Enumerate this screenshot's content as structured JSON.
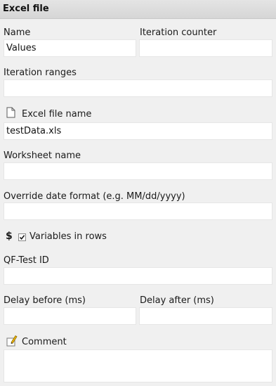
{
  "panel": {
    "title": "Excel file"
  },
  "fields": {
    "name": {
      "label": "Name",
      "value": "Values"
    },
    "iteration_counter": {
      "label": "Iteration counter",
      "value": ""
    },
    "iteration_ranges": {
      "label": "Iteration ranges",
      "value": ""
    },
    "excel_file_name": {
      "label": "Excel file name",
      "value": "testData.xls",
      "icon": "file-icon"
    },
    "worksheet_name": {
      "label": "Worksheet name",
      "value": ""
    },
    "override_date_format": {
      "label": "Override date format (e.g. MM/dd/yyyy)",
      "value": ""
    },
    "variables_in_rows": {
      "label": "Variables in rows",
      "checked": true,
      "prefix_icon": "dollar-icon",
      "prefix_text": "$"
    },
    "qftest_id": {
      "label": "QF-Test ID",
      "value": ""
    },
    "delay_before": {
      "label": "Delay before (ms)",
      "value": ""
    },
    "delay_after": {
      "label": "Delay after (ms)",
      "value": ""
    },
    "comment": {
      "label": "Comment",
      "value": "",
      "icon": "pencil-icon"
    }
  }
}
